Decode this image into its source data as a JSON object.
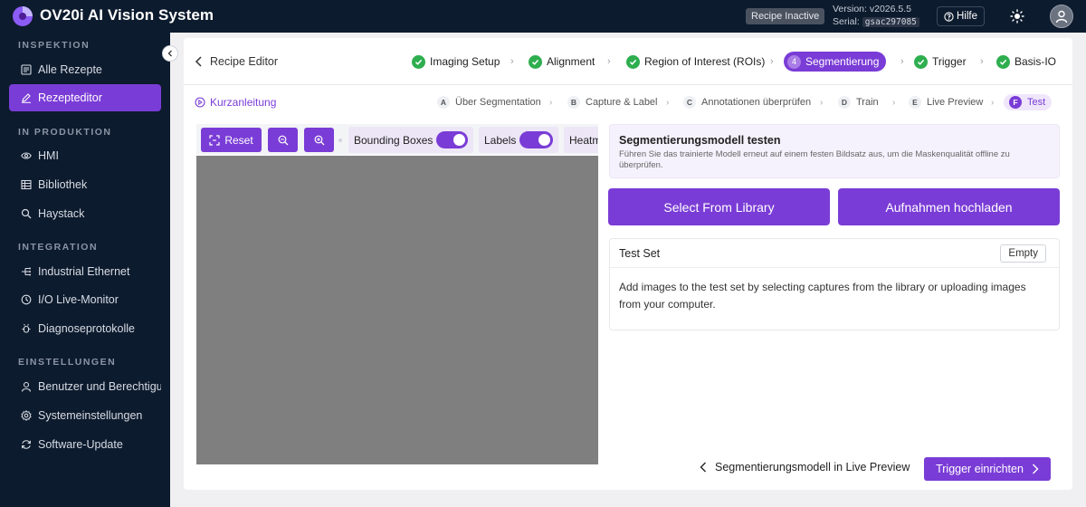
{
  "app": {
    "title": "OV20i AI Vision System"
  },
  "topbar": {
    "recipe_status": "Recipe Inactive",
    "version_label": "Version: v2026.5.5",
    "serial_label": "Serial:",
    "serial_value": "gsac297085",
    "help_label": "Hilfe"
  },
  "sidebar": {
    "sections": [
      {
        "label": "INSPEKTION"
      },
      {
        "label": "IN PRODUKTION"
      },
      {
        "label": "INTEGRATION"
      },
      {
        "label": "EINSTELLUNGEN"
      }
    ],
    "items": [
      {
        "label": "Alle Rezepte",
        "icon": "list-icon"
      },
      {
        "label": "Rezepteditor",
        "icon": "edit-icon",
        "active": true
      },
      {
        "label": "HMI",
        "icon": "eye-icon"
      },
      {
        "label": "Bibliothek",
        "icon": "grid-icon"
      },
      {
        "label": "Haystack",
        "icon": "search-icon"
      },
      {
        "label": "Industrial Ethernet",
        "icon": "network-icon"
      },
      {
        "label": "I/O Live-Monitor",
        "icon": "monitor-icon"
      },
      {
        "label": "Diagnoseprotokolle",
        "icon": "bug-icon"
      },
      {
        "label": "Benutzer und Berechtigungen",
        "icon": "user-icon"
      },
      {
        "label": "Systemeinstellungen",
        "icon": "gear-icon"
      },
      {
        "label": "Software-Update",
        "icon": "refresh-icon"
      }
    ]
  },
  "header": {
    "back_label": "Recipe Editor",
    "steps": [
      {
        "label": "Imaging Setup",
        "state": "done"
      },
      {
        "label": "Alignment",
        "state": "done"
      },
      {
        "label": "Region of Interest (ROIs)",
        "state": "done"
      },
      {
        "label": "Segmentierung",
        "state": "current",
        "number": "4"
      },
      {
        "label": "Trigger",
        "state": "done"
      },
      {
        "label": "Basis-IO",
        "state": "done"
      }
    ]
  },
  "subnav": {
    "quick_label": "Kurzanleitung",
    "steps": [
      {
        "letter": "A",
        "label": "Über Segmentation"
      },
      {
        "letter": "B",
        "label": "Capture & Label"
      },
      {
        "letter": "C",
        "label": "Annotationen überprüfen"
      },
      {
        "letter": "D",
        "label": "Train"
      },
      {
        "letter": "E",
        "label": "Live Preview"
      },
      {
        "letter": "F",
        "label": "Test",
        "current": true
      }
    ]
  },
  "viewer": {
    "reset_label": "Reset",
    "bounding_boxes_label": "Bounding Boxes",
    "bounding_boxes_on": true,
    "labels_label": "Labels",
    "labels_on": true,
    "heatmap_label": "Heatmap"
  },
  "panel": {
    "title": "Segmentierungsmodell testen",
    "description": "Führen Sie das trainierte Modell erneut auf einem festen Bildsatz aus, um die Maskenqualität offline zu überprüfen.",
    "select_library_label": "Select From Library",
    "upload_label": "Aufnahmen hochladen",
    "testset_title": "Test Set",
    "testset_badge": "Empty",
    "testset_message": "Add images to the test set by selecting captures from the library or uploading images from your computer."
  },
  "footer": {
    "back_label": "Segmentierungsmodell in Live Preview",
    "next_label": "Trigger einrichten"
  },
  "colors": {
    "accent": "#7a3cd6",
    "sidebar_bg": "#0d1b2e",
    "success": "#2eae4f",
    "canvas": "#7f7f7f"
  }
}
